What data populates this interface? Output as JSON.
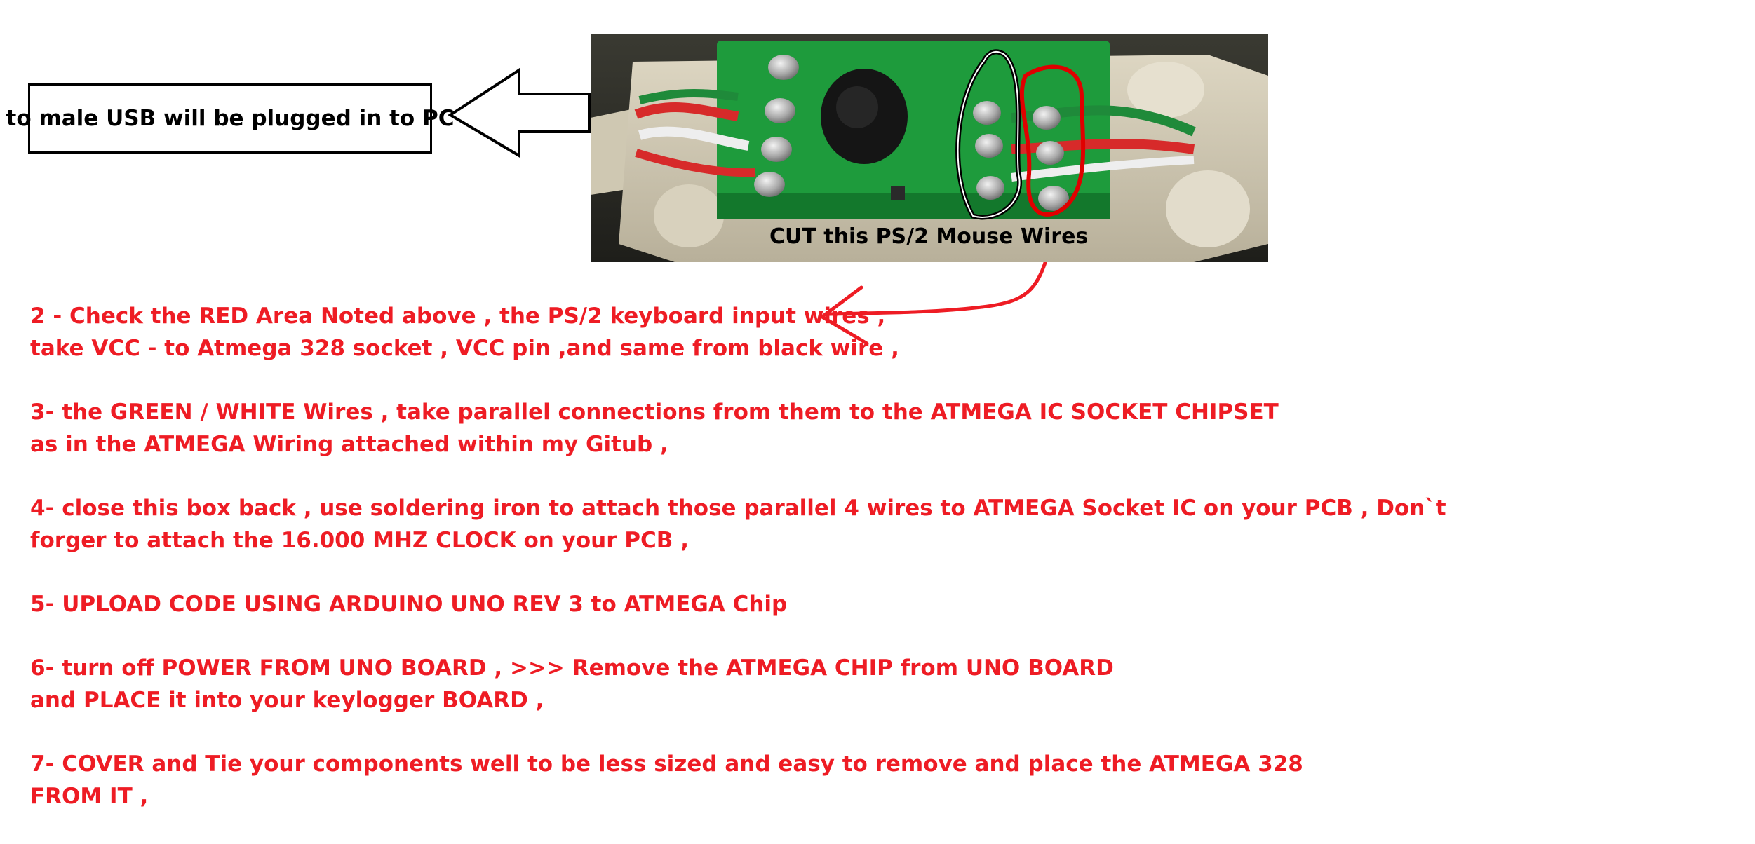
{
  "callout": {
    "label": "to male USB will be plugged in to PC",
    "arrow_icon": "left-arrow-icon"
  },
  "photo": {
    "caption": "CUT this PS/2 Mouse Wires",
    "colors": {
      "housing": "#cfc6ae",
      "pcb": "#1e9b3c",
      "wire_red": "#d72a2a",
      "wire_green": "#1f8a3a",
      "wire_white": "#eeeeee",
      "annotation_black": "#000000",
      "annotation_red": "#e00000"
    }
  },
  "annotation_arrow_color": "#ee1c24",
  "steps": [
    {
      "lines": [
        "2 - Check the RED Area Noted above  , the PS/2 keyboard input wires ,",
        "take VCC - to Atmega 328 socket  , VCC pin ,and same from black wire ,"
      ]
    },
    {
      "lines": [
        "3-  the GREEN / WHITE Wires , take parallel connections from them to the ATMEGA IC SOCKET CHIPSET",
        "as in the ATMEGA Wiring attached within my Gitub ,"
      ]
    },
    {
      "lines": [
        "4- close this box back , use soldering iron to attach those parallel 4 wires to ATMEGA Socket IC on your PCB , Don`t",
        "forger to attach the 16.000 MHZ  CLOCK on your PCB ,"
      ]
    },
    {
      "lines": [
        "5- UPLOAD CODE USING ARDUINO UNO REV 3 to ATMEGA Chip"
      ]
    },
    {
      "lines": [
        "6- turn off POWER FROM UNO BOARD , >>> Remove the ATMEGA CHIP from UNO BOARD",
        "and PLACE it into your keylogger BOARD ,"
      ]
    },
    {
      "lines": [
        "7- COVER and Tie your components well to be less sized and easy to remove and place the ATMEGA 328",
        "FROM IT ,"
      ]
    }
  ]
}
